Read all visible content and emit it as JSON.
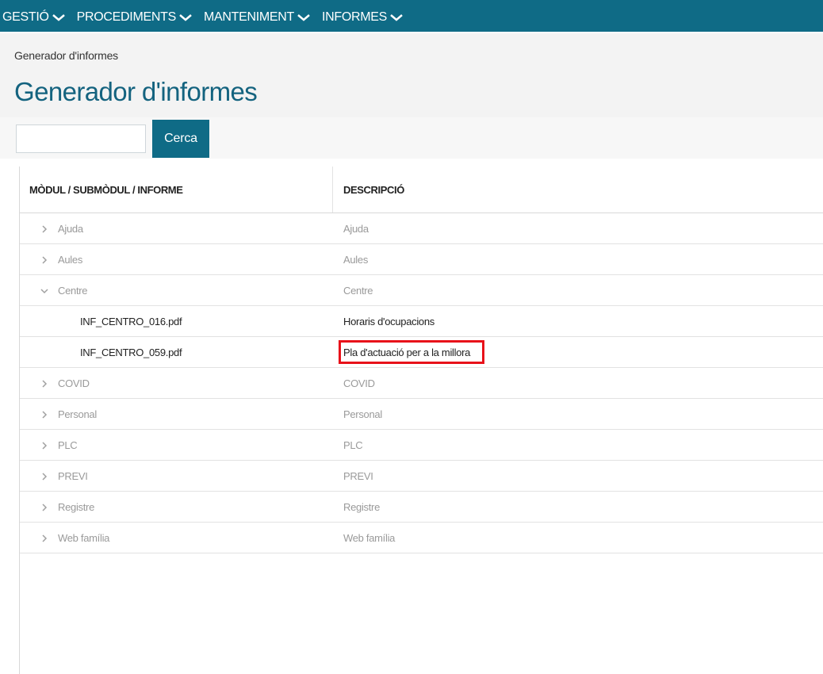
{
  "nav": {
    "items": [
      {
        "label": "GESTIÓ"
      },
      {
        "label": "PROCEDIMENTS"
      },
      {
        "label": "MANTENIMENT"
      },
      {
        "label": "INFORMES"
      }
    ]
  },
  "breadcrumb": "Generador d'informes",
  "page_title": "Generador d'informes",
  "search": {
    "value": "",
    "button_label": "Cerca"
  },
  "table": {
    "headers": [
      "MÒDUL / SUBMÒDUL / INFORME",
      "DESCRIPCIÓ"
    ],
    "rows": [
      {
        "toggle": ">",
        "name": "Ajuda",
        "description": "Ajuda"
      },
      {
        "toggle": ">",
        "name": "Aules",
        "description": "Aules"
      },
      {
        "toggle": "v",
        "name": "Centre",
        "description": "Centre"
      },
      {
        "toggle": "",
        "name": "INF_CENTRO_016.pdf",
        "description": "Horaris d'ocupacions"
      },
      {
        "toggle": "",
        "name": "INF_CENTRO_059.pdf",
        "description": "Pla d'actuació per a la millora"
      },
      {
        "toggle": ">",
        "name": "COVID",
        "description": "COVID"
      },
      {
        "toggle": ">",
        "name": "Personal",
        "description": "Personal"
      },
      {
        "toggle": ">",
        "name": "PLC",
        "description": "PLC"
      },
      {
        "toggle": ">",
        "name": "PREVI",
        "description": "PREVI"
      },
      {
        "toggle": ">",
        "name": "Registre",
        "description": "Registre"
      },
      {
        "toggle": ">",
        "name": "Web família",
        "description": "Web família"
      }
    ]
  },
  "colors": {
    "nav_bg": "#0f6b86",
    "title": "#14637f",
    "highlight": "#e8121a"
  }
}
